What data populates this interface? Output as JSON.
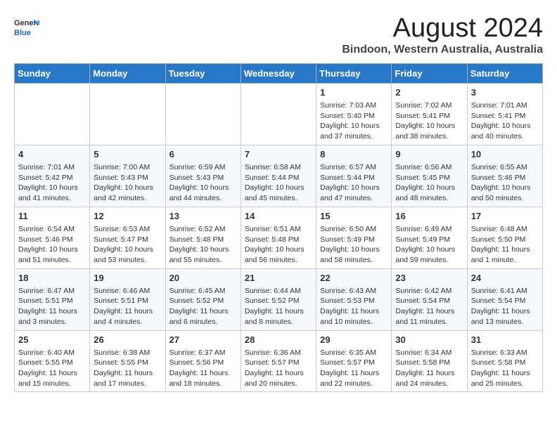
{
  "header": {
    "logo_general": "General",
    "logo_blue": "Blue",
    "title": "August 2024",
    "subtitle": "Bindoon, Western Australia, Australia"
  },
  "days_of_week": [
    "Sunday",
    "Monday",
    "Tuesday",
    "Wednesday",
    "Thursday",
    "Friday",
    "Saturday"
  ],
  "weeks": [
    [
      {
        "day": "",
        "info": ""
      },
      {
        "day": "",
        "info": ""
      },
      {
        "day": "",
        "info": ""
      },
      {
        "day": "",
        "info": ""
      },
      {
        "day": "1",
        "info": "Sunrise: 7:03 AM\nSunset: 5:40 PM\nDaylight: 10 hours\nand 37 minutes."
      },
      {
        "day": "2",
        "info": "Sunrise: 7:02 AM\nSunset: 5:41 PM\nDaylight: 10 hours\nand 38 minutes."
      },
      {
        "day": "3",
        "info": "Sunrise: 7:01 AM\nSunset: 5:41 PM\nDaylight: 10 hours\nand 40 minutes."
      }
    ],
    [
      {
        "day": "4",
        "info": "Sunrise: 7:01 AM\nSunset: 5:42 PM\nDaylight: 10 hours\nand 41 minutes."
      },
      {
        "day": "5",
        "info": "Sunrise: 7:00 AM\nSunset: 5:43 PM\nDaylight: 10 hours\nand 42 minutes."
      },
      {
        "day": "6",
        "info": "Sunrise: 6:59 AM\nSunset: 5:43 PM\nDaylight: 10 hours\nand 44 minutes."
      },
      {
        "day": "7",
        "info": "Sunrise: 6:58 AM\nSunset: 5:44 PM\nDaylight: 10 hours\nand 45 minutes."
      },
      {
        "day": "8",
        "info": "Sunrise: 6:57 AM\nSunset: 5:44 PM\nDaylight: 10 hours\nand 47 minutes."
      },
      {
        "day": "9",
        "info": "Sunrise: 6:56 AM\nSunset: 5:45 PM\nDaylight: 10 hours\nand 48 minutes."
      },
      {
        "day": "10",
        "info": "Sunrise: 6:55 AM\nSunset: 5:46 PM\nDaylight: 10 hours\nand 50 minutes."
      }
    ],
    [
      {
        "day": "11",
        "info": "Sunrise: 6:54 AM\nSunset: 5:46 PM\nDaylight: 10 hours\nand 51 minutes."
      },
      {
        "day": "12",
        "info": "Sunrise: 6:53 AM\nSunset: 5:47 PM\nDaylight: 10 hours\nand 53 minutes."
      },
      {
        "day": "13",
        "info": "Sunrise: 6:52 AM\nSunset: 5:48 PM\nDaylight: 10 hours\nand 55 minutes."
      },
      {
        "day": "14",
        "info": "Sunrise: 6:51 AM\nSunset: 5:48 PM\nDaylight: 10 hours\nand 56 minutes."
      },
      {
        "day": "15",
        "info": "Sunrise: 6:50 AM\nSunset: 5:49 PM\nDaylight: 10 hours\nand 58 minutes."
      },
      {
        "day": "16",
        "info": "Sunrise: 6:49 AM\nSunset: 5:49 PM\nDaylight: 10 hours\nand 59 minutes."
      },
      {
        "day": "17",
        "info": "Sunrise: 6:48 AM\nSunset: 5:50 PM\nDaylight: 11 hours\nand 1 minute."
      }
    ],
    [
      {
        "day": "18",
        "info": "Sunrise: 6:47 AM\nSunset: 5:51 PM\nDaylight: 11 hours\nand 3 minutes."
      },
      {
        "day": "19",
        "info": "Sunrise: 6:46 AM\nSunset: 5:51 PM\nDaylight: 11 hours\nand 4 minutes."
      },
      {
        "day": "20",
        "info": "Sunrise: 6:45 AM\nSunset: 5:52 PM\nDaylight: 11 hours\nand 6 minutes."
      },
      {
        "day": "21",
        "info": "Sunrise: 6:44 AM\nSunset: 5:52 PM\nDaylight: 11 hours\nand 8 minutes."
      },
      {
        "day": "22",
        "info": "Sunrise: 6:43 AM\nSunset: 5:53 PM\nDaylight: 11 hours\nand 10 minutes."
      },
      {
        "day": "23",
        "info": "Sunrise: 6:42 AM\nSunset: 5:54 PM\nDaylight: 11 hours\nand 11 minutes."
      },
      {
        "day": "24",
        "info": "Sunrise: 6:41 AM\nSunset: 5:54 PM\nDaylight: 11 hours\nand 13 minutes."
      }
    ],
    [
      {
        "day": "25",
        "info": "Sunrise: 6:40 AM\nSunset: 5:55 PM\nDaylight: 11 hours\nand 15 minutes."
      },
      {
        "day": "26",
        "info": "Sunrise: 6:38 AM\nSunset: 5:55 PM\nDaylight: 11 hours\nand 17 minutes."
      },
      {
        "day": "27",
        "info": "Sunrise: 6:37 AM\nSunset: 5:56 PM\nDaylight: 11 hours\nand 18 minutes."
      },
      {
        "day": "28",
        "info": "Sunrise: 6:36 AM\nSunset: 5:57 PM\nDaylight: 11 hours\nand 20 minutes."
      },
      {
        "day": "29",
        "info": "Sunrise: 6:35 AM\nSunset: 5:57 PM\nDaylight: 11 hours\nand 22 minutes."
      },
      {
        "day": "30",
        "info": "Sunrise: 6:34 AM\nSunset: 5:58 PM\nDaylight: 11 hours\nand 24 minutes."
      },
      {
        "day": "31",
        "info": "Sunrise: 6:33 AM\nSunset: 5:58 PM\nDaylight: 11 hours\nand 25 minutes."
      }
    ]
  ]
}
